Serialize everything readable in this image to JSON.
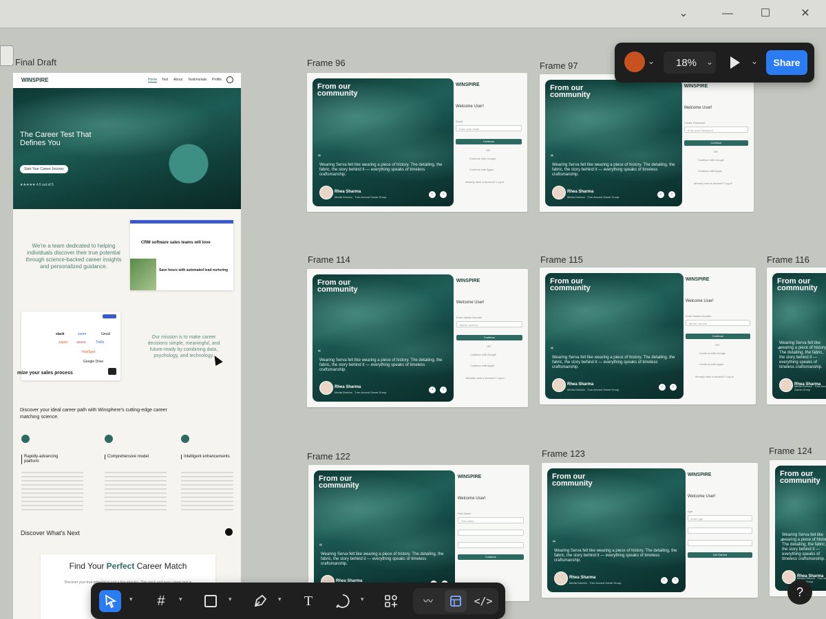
{
  "window": {
    "minimize": "—",
    "maximize": "☐",
    "close": "✕",
    "chevron": "⌄"
  },
  "topbar": {
    "zoom": "18%",
    "share_label": "Share",
    "play_icon": "play-icon",
    "chevron": "⌄"
  },
  "draft": {
    "label": "Final Draft",
    "logo": "WINSPIRE",
    "nav": [
      "Home",
      "Test",
      "About",
      "Testimonials",
      "Profile"
    ],
    "hero_title": "The Career Test That Defines You",
    "hero_cta": "Start Your Career Journey",
    "rating": "★★★★★ 4.5 out of 5",
    "intro_text": "We're a team dedicated to helping individuals discover their true potential through science-backed career insights and personalized guidance.",
    "crm_title": "CRM software sales teams will love",
    "crm_sub": "Save hours with automated lead nurturing",
    "logos": [
      "slack",
      "zoom",
      "Gmail",
      "zapier",
      "asana",
      "Trello",
      "HubSpot",
      "Google Drive"
    ],
    "maximize_text": "mize your sales process",
    "mission_text": "Our mission is to make career decisions simple, meaningful, and future-ready by combining data, psychology, and technology.",
    "discover_path": "Discover your ideal career path with Winsphere's cutting-edge career matching science.",
    "features": [
      {
        "title": "Rapidly-advancing platform"
      },
      {
        "title": "Comprehensive model"
      },
      {
        "title": "Intelligent enhancements"
      }
    ],
    "discover_next": "Discover What's Next",
    "find_match_pre": "Find Your ",
    "find_match_em": "Perfect",
    "find_match_post": " Career Match",
    "find_match_sub": "Discover your true potential in just a few minutes. This quick and easy career test is designed to"
  },
  "frames": [
    {
      "label": "Frame 96",
      "field_label": "Email",
      "field_placeholder": "Enter your email"
    },
    {
      "label": "Frame 97",
      "field_label": "Create Password",
      "field_placeholder": "Enter your Password"
    },
    {
      "label": "Frame 114",
      "field_label": "Enter Mobile Number",
      "field_placeholder": "Mobile number"
    },
    {
      "label": "Frame 115",
      "field_label": "Enter Mobile Number",
      "field_placeholder": "Mobile number"
    },
    {
      "label": "Frame 122",
      "field_label": "First Name",
      "field_placeholder": "First name"
    },
    {
      "label": "Frame 123",
      "field_label": "Age",
      "field_placeholder": "Enter age"
    },
    {
      "label": "Frame 116"
    },
    {
      "label": "Frame 124"
    }
  ],
  "frame_common": {
    "hero_title_1": "From our",
    "hero_title_2": "community",
    "quote": "Wearing Serva felt like wearing a piece of history. The detailing, the fabric, the story behind it — everything speaks of timeless craftsmanship.",
    "name": "Rhea Sharma",
    "role": "Media Director , Turn Around Game Group",
    "logo": "WINSPIRE",
    "welcome": "Welcome User!",
    "continue": "Continue",
    "get_started": "Get Started",
    "google": "Continue with Google",
    "apple": "Continue with Apple",
    "login": "Already have a account? Log in",
    "or": "OR"
  },
  "toolbar": {
    "tools": [
      "move-tool",
      "frame-tool",
      "shape-tool",
      "pen-tool",
      "text-tool",
      "comment-tool",
      "actions-tool",
      "draw-mode",
      "design-mode",
      "dev-mode"
    ],
    "text_glyph": "T"
  },
  "help": "?"
}
